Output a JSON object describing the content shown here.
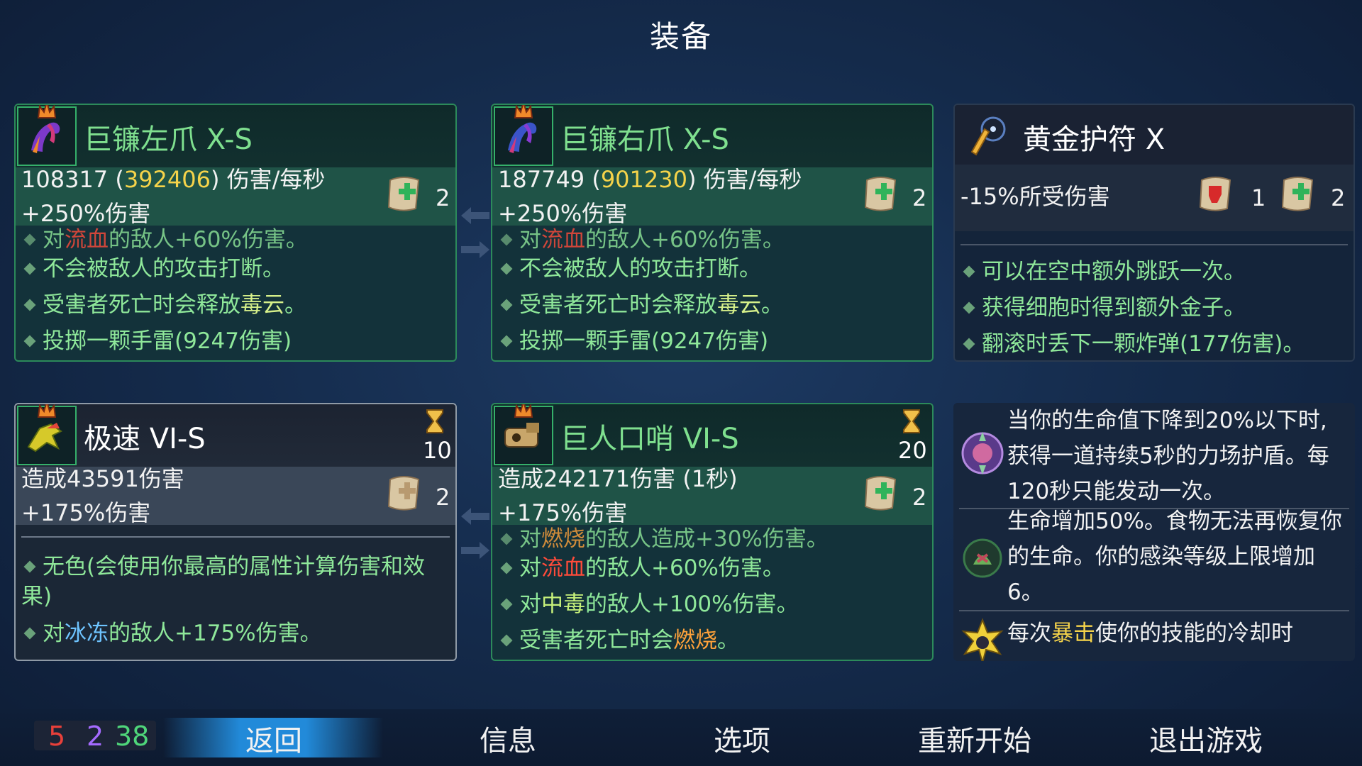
{
  "title": "装备",
  "weapons": [
    {
      "name": "巨镰左爪 X-S",
      "dps_base": "108317",
      "dps_crit": "392406",
      "dps_unit": "伤害/每秒",
      "bonus": "+250%伤害",
      "scroll_count": "2",
      "cut_text": "对流血的敌人+60%伤害。",
      "features": [
        "不会被敌人的攻击打断。",
        "受害者死亡时会释放毒云。",
        "投掷一颗手雷(9247伤害)"
      ]
    },
    {
      "name": "巨镰右爪 X-S",
      "dps_base": "187749",
      "dps_crit": "901230",
      "dps_unit": "伤害/每秒",
      "bonus": "+250%伤害",
      "scroll_count": "2",
      "cut_text": "对流血的敌人+60%伤害。",
      "features": [
        "不会被敌人的攻击打断。",
        "受害者死亡时会释放毒云。",
        "投掷一颗手雷(9247伤害)"
      ]
    }
  ],
  "amulet": {
    "name": "黄金护符 X",
    "stat": "-15%所受伤害",
    "scroll_red_count": "1",
    "scroll_green_count": "2",
    "features": [
      "可以在空中额外跳跃一次。",
      "获得细胞时得到额外金子。",
      "翻滚时丢下一颗炸弹(177伤害)。"
    ]
  },
  "skills": [
    {
      "name": "极速 VI-S",
      "cooldown": "10",
      "damage": "造成43591伤害",
      "bonus": "+175%伤害",
      "scroll_count": "2",
      "features": [
        "无色(会使用你最高的属性计算伤害和效果)",
        "对冰冻的敌人+175%伤害。"
      ]
    },
    {
      "name": "巨人口哨 VI-S",
      "cooldown": "20",
      "damage": "造成242171伤害 (1秒)",
      "bonus": "+175%伤害",
      "scroll_count": "2",
      "cut_text": "对燃烧的敌人造成+30%伤害。",
      "features": [
        "对流血的敌人+60%伤害。",
        "对中毒的敌人+100%伤害。",
        "受害者死亡时会燃烧。"
      ]
    }
  ],
  "passives": [
    {
      "icon": "force-shield-icon",
      "text": "当你的生命值下降到20%以下时,获得一道持续5秒的力场护盾。每120秒只能发动一次。"
    },
    {
      "icon": "necromancy-icon",
      "text": "生命增加50%。食物无法再恢复你的生命。你的感染等级上限增加6。"
    },
    {
      "icon": "crit-cooldown-icon",
      "text": "每次暴击使你的技能的冷却时"
    }
  ],
  "stats": {
    "brutality": "5",
    "tactics": "2",
    "survival": "38"
  },
  "menu": {
    "back": "返回",
    "info": "信息",
    "options": "选项",
    "restart": "重新开始",
    "quit": "退出游戏"
  },
  "colors": {
    "brutality": "#e8403a",
    "tactics": "#a56bff",
    "survival": "#4fd67a",
    "accent_bar": "#2496eb"
  }
}
